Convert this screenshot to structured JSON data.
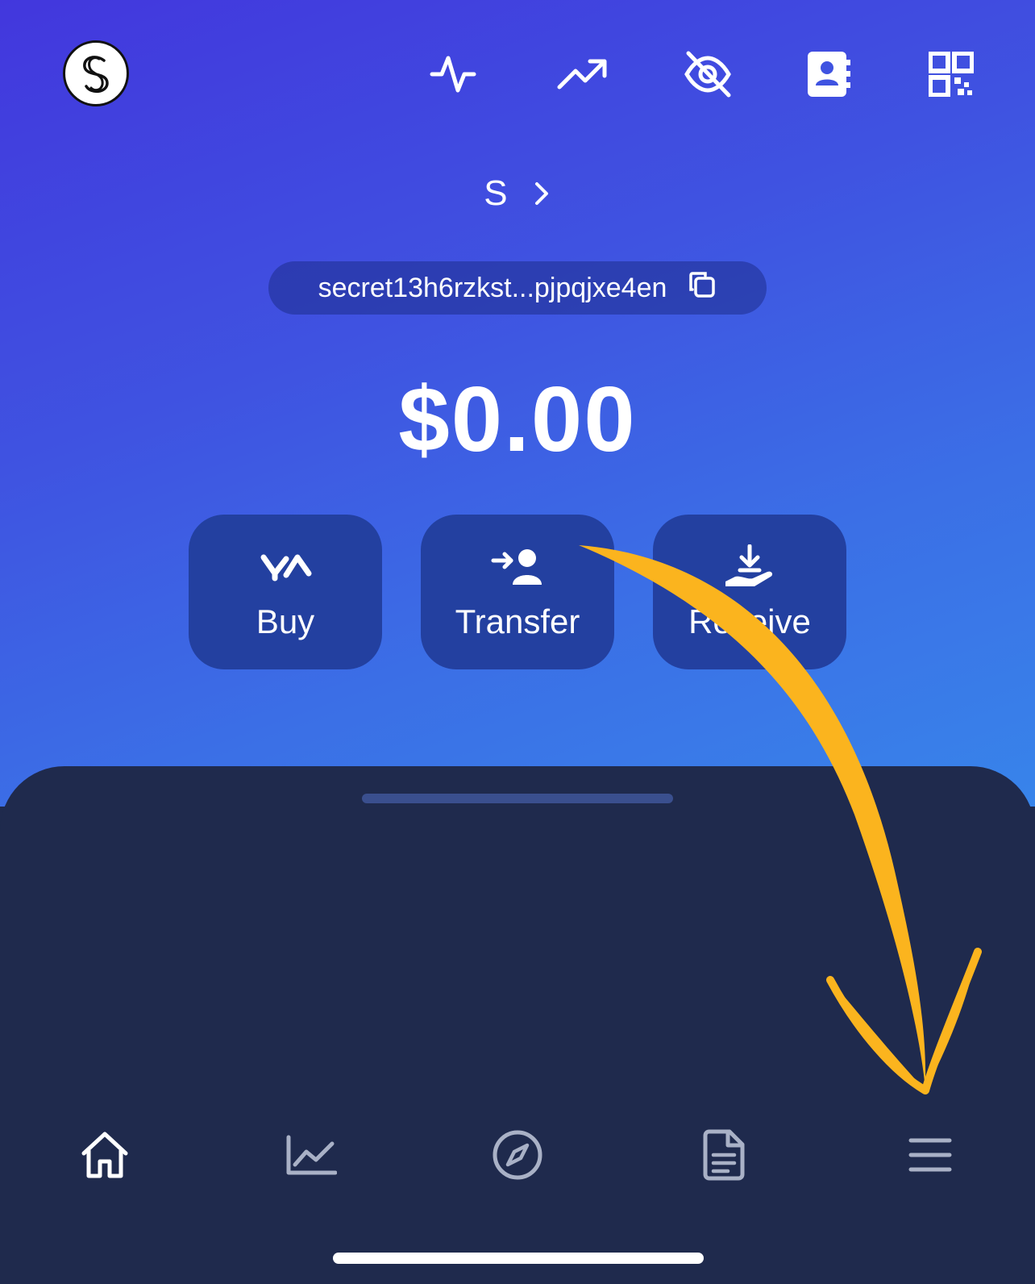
{
  "header": {
    "logo_letter": "S",
    "icons": [
      "activity-icon",
      "trending-up-icon",
      "eye-off-icon",
      "contacts-icon",
      "qr-code-icon"
    ]
  },
  "account": {
    "name": "S"
  },
  "address": {
    "text": "secret13h6rzkst...pjpqjxe4en"
  },
  "balance": {
    "text": "$0.00"
  },
  "actions": [
    {
      "label": "Buy",
      "icon": "buy-arrows-icon"
    },
    {
      "label": "Transfer",
      "icon": "transfer-user-icon"
    },
    {
      "label": "Receive",
      "icon": "receive-hand-icon"
    }
  ],
  "bottom_nav": {
    "items": [
      "home-icon",
      "chart-icon",
      "compass-icon",
      "document-icon",
      "menu-icon"
    ]
  },
  "colors": {
    "gradient_top": "#4237dd",
    "gradient_bottom": "#3884ea",
    "button_bg": "#2340a0",
    "sheet_bg": "#1f2a4d",
    "annotation_arrow": "#fbb41e"
  }
}
